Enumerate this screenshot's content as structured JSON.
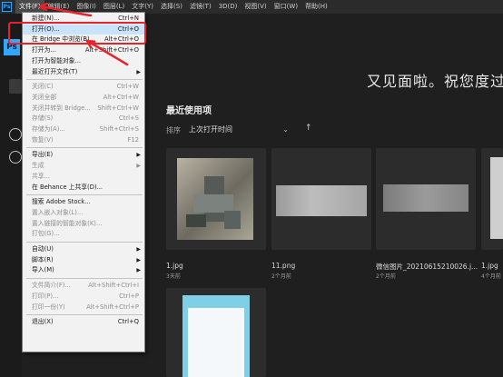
{
  "app": {
    "logo_text": "Ps"
  },
  "menubar": {
    "items": [
      {
        "label": "文件(F)",
        "active": true
      },
      {
        "label": "编辑(E)"
      },
      {
        "label": "图像(I)"
      },
      {
        "label": "图层(L)"
      },
      {
        "label": "文字(Y)"
      },
      {
        "label": "选择(S)"
      },
      {
        "label": "滤镜(T)"
      },
      {
        "label": "3D(D)"
      },
      {
        "label": "视图(V)"
      },
      {
        "label": "窗口(W)"
      },
      {
        "label": "帮助(H)"
      }
    ]
  },
  "sidebar": {
    "ps_square": "Ps"
  },
  "home": {
    "welcome": "又见面啦。祝您度过",
    "recent_title": "最近使用项",
    "sort_label": "排序",
    "sort_value": "上次打开时间",
    "sort_dir_icon": "↑"
  },
  "recent_files": [
    {
      "name": "1.jpg",
      "time": "3天前"
    },
    {
      "name": "11.png",
      "time": "2个月前"
    },
    {
      "name": "微信图片_20210615210026.j...",
      "time": "2个月前"
    },
    {
      "name": "1.jpg",
      "time": "4个月前"
    },
    {
      "name": "",
      "time": ""
    }
  ],
  "file_menu": {
    "items": [
      {
        "label": "新建(N)...",
        "shortcut": "Ctrl+N"
      },
      {
        "label": "打开(O)...",
        "shortcut": "Ctrl+O",
        "highlighted": true
      },
      {
        "label": "在 Bridge 中浏览(B)...",
        "shortcut": "Alt+Ctrl+O"
      },
      {
        "label": "打开为...",
        "shortcut": "Alt+Shift+Ctrl+O"
      },
      {
        "label": "打开为智能对象...",
        "shortcut": ""
      },
      {
        "label": "最近打开文件(T)",
        "submenu": true
      },
      {
        "label": "关闭(C)",
        "shortcut": "Ctrl+W",
        "disabled": true
      },
      {
        "label": "关闭全部",
        "shortcut": "Alt+Ctrl+W",
        "disabled": true
      },
      {
        "label": "关闭并转到 Bridge...",
        "shortcut": "Shift+Ctrl+W",
        "disabled": true
      },
      {
        "label": "存储(S)",
        "shortcut": "Ctrl+S",
        "disabled": true
      },
      {
        "label": "存储为(A)...",
        "shortcut": "Shift+Ctrl+S",
        "disabled": true
      },
      {
        "label": "恢复(V)",
        "shortcut": "F12",
        "disabled": true
      },
      {
        "label": "导出(E)",
        "submenu": true
      },
      {
        "label": "生成",
        "submenu": true,
        "disabled": true
      },
      {
        "label": "共享...",
        "shortcut": "",
        "disabled": true
      },
      {
        "label": "在 Behance 上共享(D)...",
        "shortcut": ""
      },
      {
        "label": "搜索 Adobe Stock...",
        "shortcut": ""
      },
      {
        "label": "置入嵌入对象(L)...",
        "shortcut": "",
        "disabled": true
      },
      {
        "label": "置入链接的智能对象(K)...",
        "shortcut": "",
        "disabled": true
      },
      {
        "label": "打包(G)...",
        "shortcut": "",
        "disabled": true
      },
      {
        "label": "自动(U)",
        "submenu": true
      },
      {
        "label": "脚本(R)",
        "submenu": true
      },
      {
        "label": "导入(M)",
        "submenu": true
      },
      {
        "label": "文件简介(F)...",
        "shortcut": "Alt+Shift+Ctrl+I",
        "disabled": true
      },
      {
        "label": "打印(P)...",
        "shortcut": "Ctrl+P",
        "disabled": true
      },
      {
        "label": "打印一份(Y)",
        "shortcut": "Alt+Shift+Ctrl+P",
        "disabled": true
      },
      {
        "label": "退出(X)",
        "shortcut": "Ctrl+Q"
      }
    ]
  },
  "colors": {
    "annotation": "#e8222a",
    "accent": "#31a8ff",
    "menu_highlight": "#c9e3fb"
  }
}
